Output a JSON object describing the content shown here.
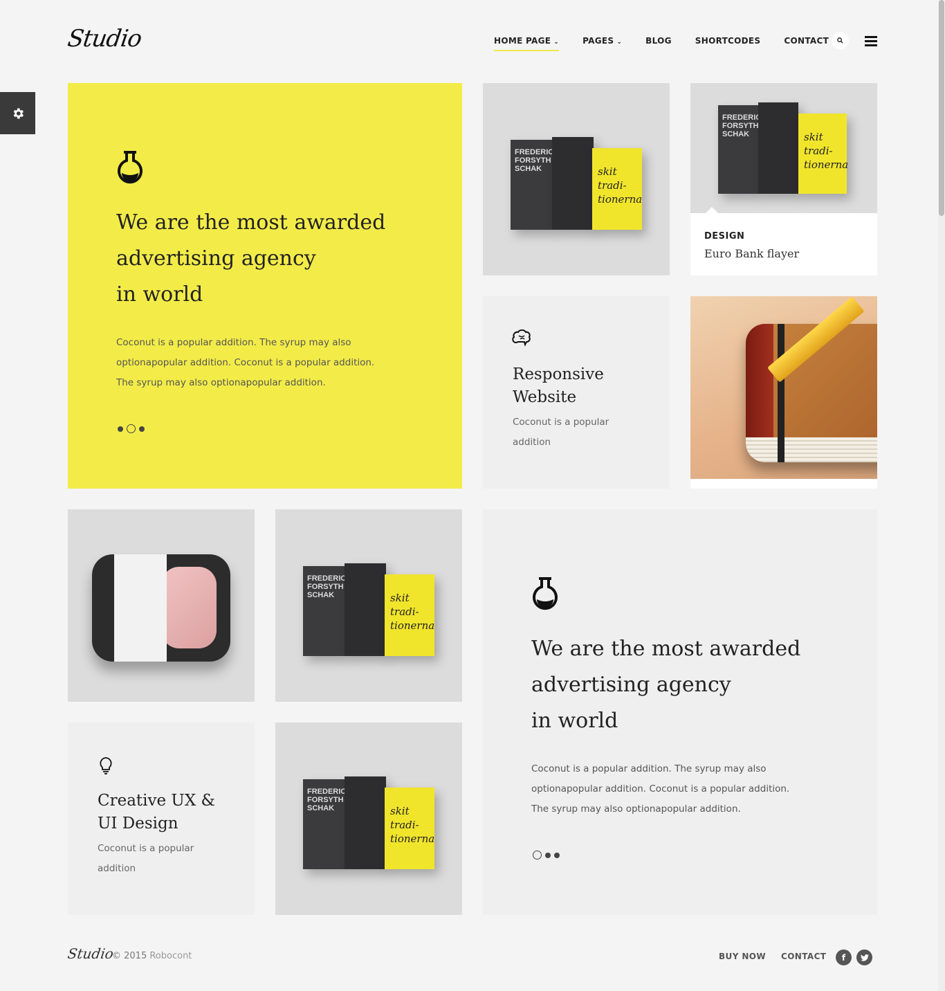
{
  "brand": {
    "logo": "Studio"
  },
  "nav": {
    "items": [
      {
        "label": "HOME PAGE",
        "has_dropdown": true,
        "active": true
      },
      {
        "label": "PAGES",
        "has_dropdown": true,
        "active": false
      },
      {
        "label": "BLOG",
        "has_dropdown": false,
        "active": false
      },
      {
        "label": "SHORTCODES",
        "has_dropdown": false,
        "active": false
      },
      {
        "label": "CONTACT",
        "has_dropdown": false,
        "active": false
      }
    ],
    "search_icon": "search-icon",
    "menu_icon": "hamburger-menu-icon"
  },
  "settings": {
    "icon": "gear-icon"
  },
  "hero": {
    "icon": "flask-icon",
    "heading_line1": "We are the most awarded",
    "heading_line2": "advertising agency",
    "heading_line3": "in world",
    "body_line1": "Coconut is a popular addition. The syrup may also",
    "body_line2": "optionapopular addition. Coconut is a popular addition.",
    "body_line3": "The syrup may also optionapopular addition.",
    "active_slide": 2,
    "slide_count": 3
  },
  "books": {
    "book1_lines": [
      "FREDERICK",
      "FORSYTH",
      "SCHAK"
    ],
    "book3_text": "skit tradi- tionerna"
  },
  "design_card": {
    "category": "DESIGN",
    "title": "Euro Bank flayer"
  },
  "service_responsive": {
    "icon": "brain-icon",
    "title_line1": "Responsive",
    "title_line2": "Website",
    "text_line1": "Coconut is a popular",
    "text_line2": "addition"
  },
  "service_creative": {
    "icon": "lightbulb-icon",
    "title_line1": "Creative UX &",
    "title_line2": "UI Design",
    "text_line1": "Coconut is a popular",
    "text_line2": "addition"
  },
  "hero2": {
    "icon": "flask-icon",
    "heading_line1": "We are the most awarded",
    "heading_line2": "advertising agency",
    "heading_line3": "in world",
    "body_line1": "Coconut is a popular addition. The syrup may also",
    "body_line2": "optionapopular addition. Coconut is a popular addition.",
    "body_line3": "The syrup may also optionapopular addition.",
    "active_slide": 1,
    "slide_count": 3
  },
  "footer": {
    "logo": "Studio",
    "copyright": "© 2015",
    "company": "Robocont",
    "links": [
      "BUY NOW",
      "CONTACT"
    ],
    "social": [
      "facebook-icon",
      "twitter-icon"
    ]
  },
  "colors": {
    "accent": "#f3ec48",
    "dark": "#3a3a3a",
    "tile_grey": "#efefef"
  }
}
